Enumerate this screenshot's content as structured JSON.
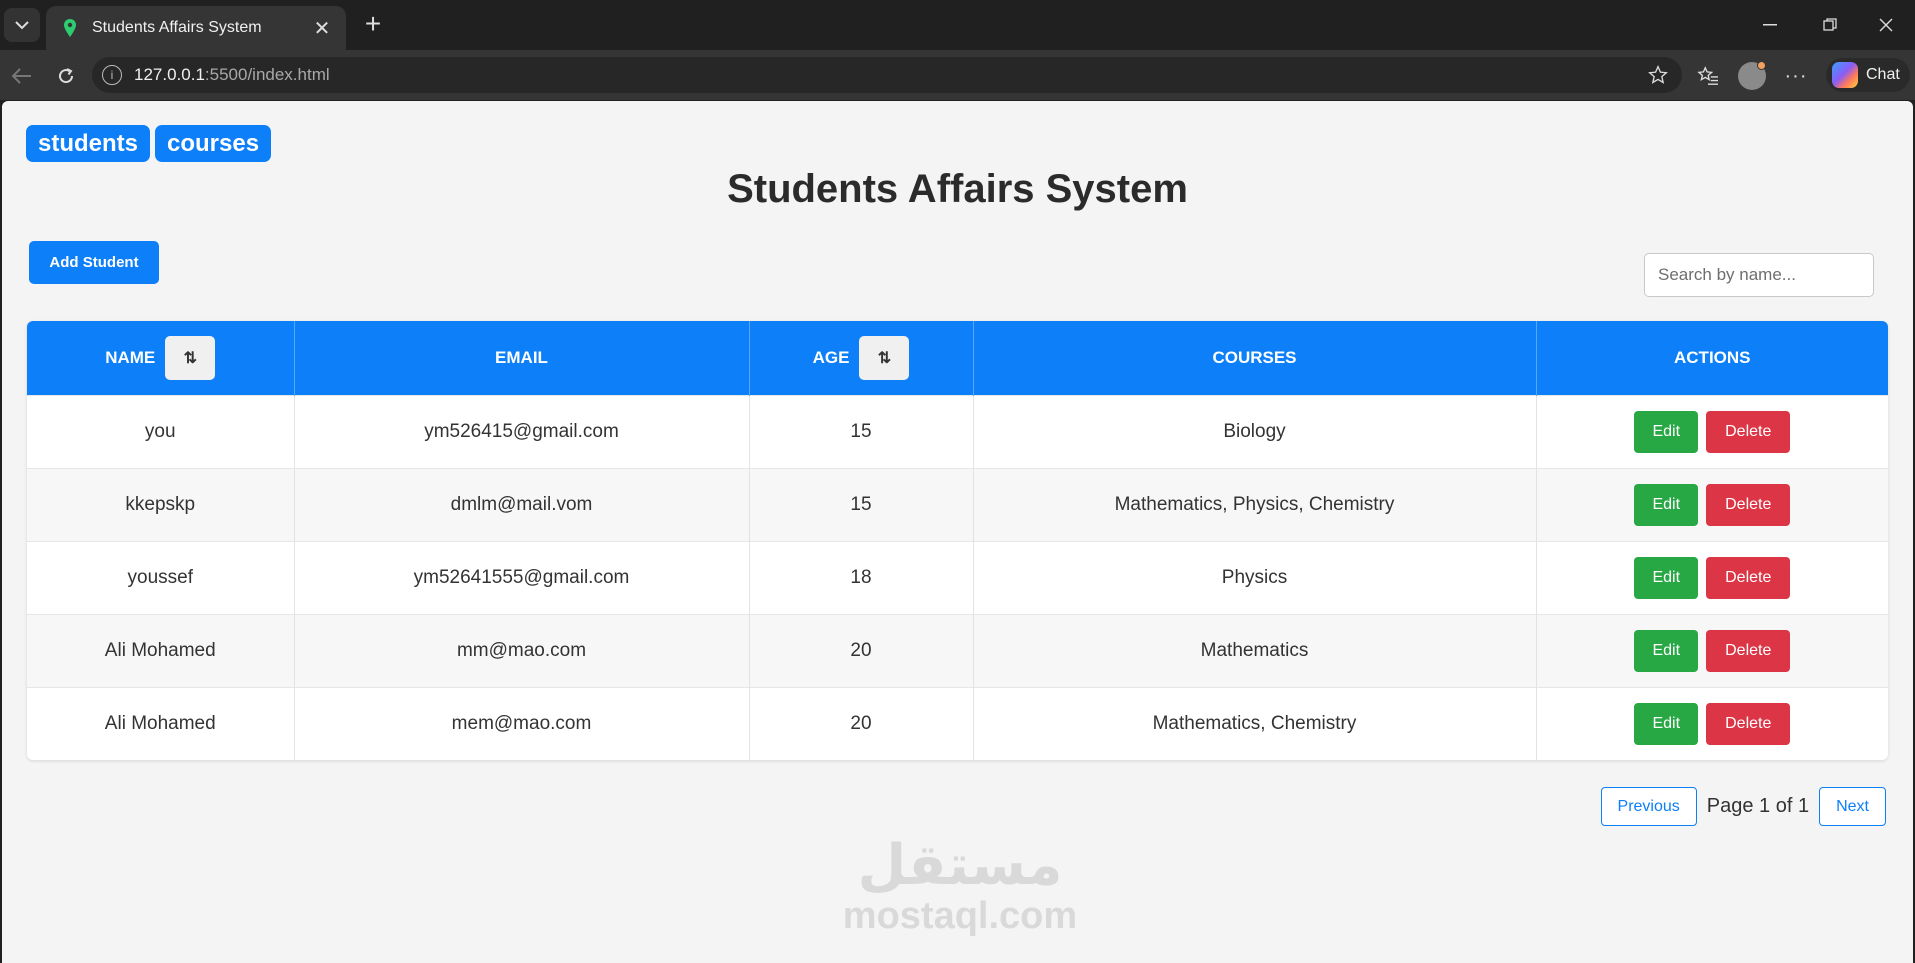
{
  "browser": {
    "tab_title": "Students Affairs System",
    "url_host": "127.0.0.1",
    "url_rest": ":5500/index.html",
    "chat_label": "Chat"
  },
  "nav": {
    "students": "students",
    "courses": "courses"
  },
  "page": {
    "title": "Students Affairs System",
    "add_button": "Add Student",
    "search_placeholder": "Search by name..."
  },
  "table": {
    "headers": {
      "name": "NAME",
      "email": "EMAIL",
      "age": "AGE",
      "courses": "COURSES",
      "actions": "ACTIONS"
    },
    "sort_icon": "⇅",
    "edit_label": "Edit",
    "delete_label": "Delete",
    "rows": [
      {
        "name": "you",
        "email": "ym526415@gmail.com",
        "age": "15",
        "courses": "Biology"
      },
      {
        "name": "kkepskp",
        "email": "dmlm@mail.vom",
        "age": "15",
        "courses": "Mathematics, Physics, Chemistry"
      },
      {
        "name": "youssef",
        "email": "ym52641555@gmail.com",
        "age": "18",
        "courses": "Physics"
      },
      {
        "name": "Ali Mohamed",
        "email": "mm@mao.com",
        "age": "20",
        "courses": "Mathematics"
      },
      {
        "name": "Ali Mohamed",
        "email": "mem@mao.com",
        "age": "20",
        "courses": "Mathematics, Chemistry"
      }
    ]
  },
  "pagination": {
    "previous": "Previous",
    "status": "Page 1 of 1",
    "next": "Next"
  },
  "watermark": {
    "arabic": "مستقل",
    "latin": "mostaql.com"
  },
  "colors": {
    "primary": "#0d7ff8",
    "edit": "#28a745",
    "delete": "#dc3545"
  }
}
